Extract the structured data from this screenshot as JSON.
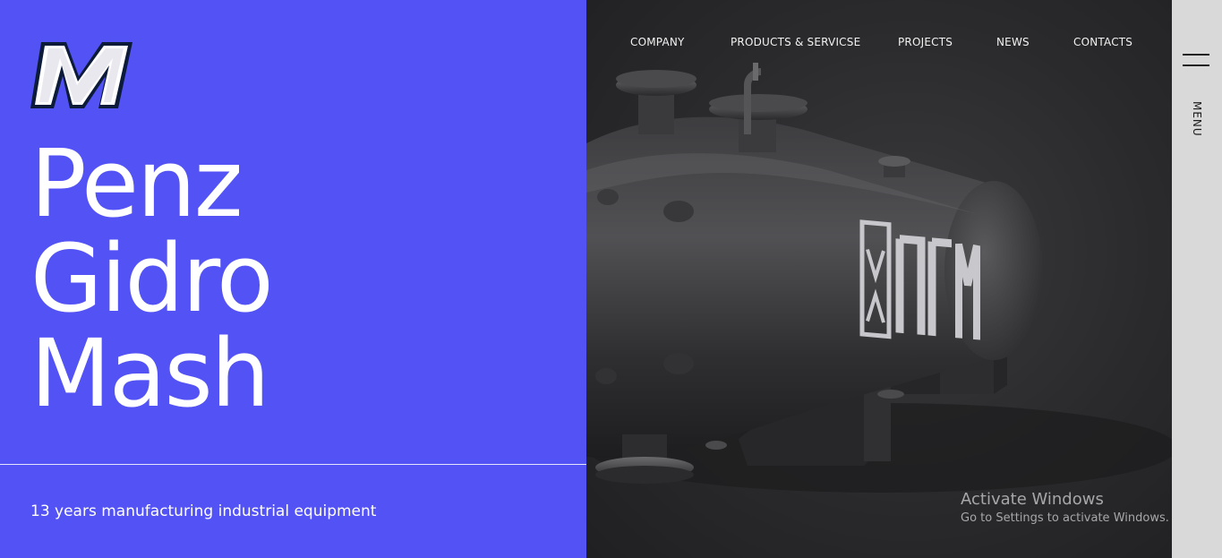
{
  "brand": {
    "logo_icon": "m-logo-icon",
    "title_lines": [
      "Penz",
      "Gidro",
      "Mash"
    ],
    "tagline": "13 years manufacturing industrial equipment",
    "accent_color": "#5352f5"
  },
  "nav": {
    "items": [
      {
        "label": "COMPANY"
      },
      {
        "label": "PRODUCTS & SERVICSE"
      },
      {
        "label": "PROJECTS"
      },
      {
        "label": "NEWS"
      },
      {
        "label": "CONTACTS"
      }
    ]
  },
  "hero_image": {
    "tank_marking": "ПГМ",
    "description_icon": "industrial-tank-image"
  },
  "menu": {
    "label": "MENU",
    "icon": "hamburger-icon"
  },
  "os_watermark": {
    "title": "Activate Windows",
    "subtitle": "Go to Settings to activate Windows."
  }
}
